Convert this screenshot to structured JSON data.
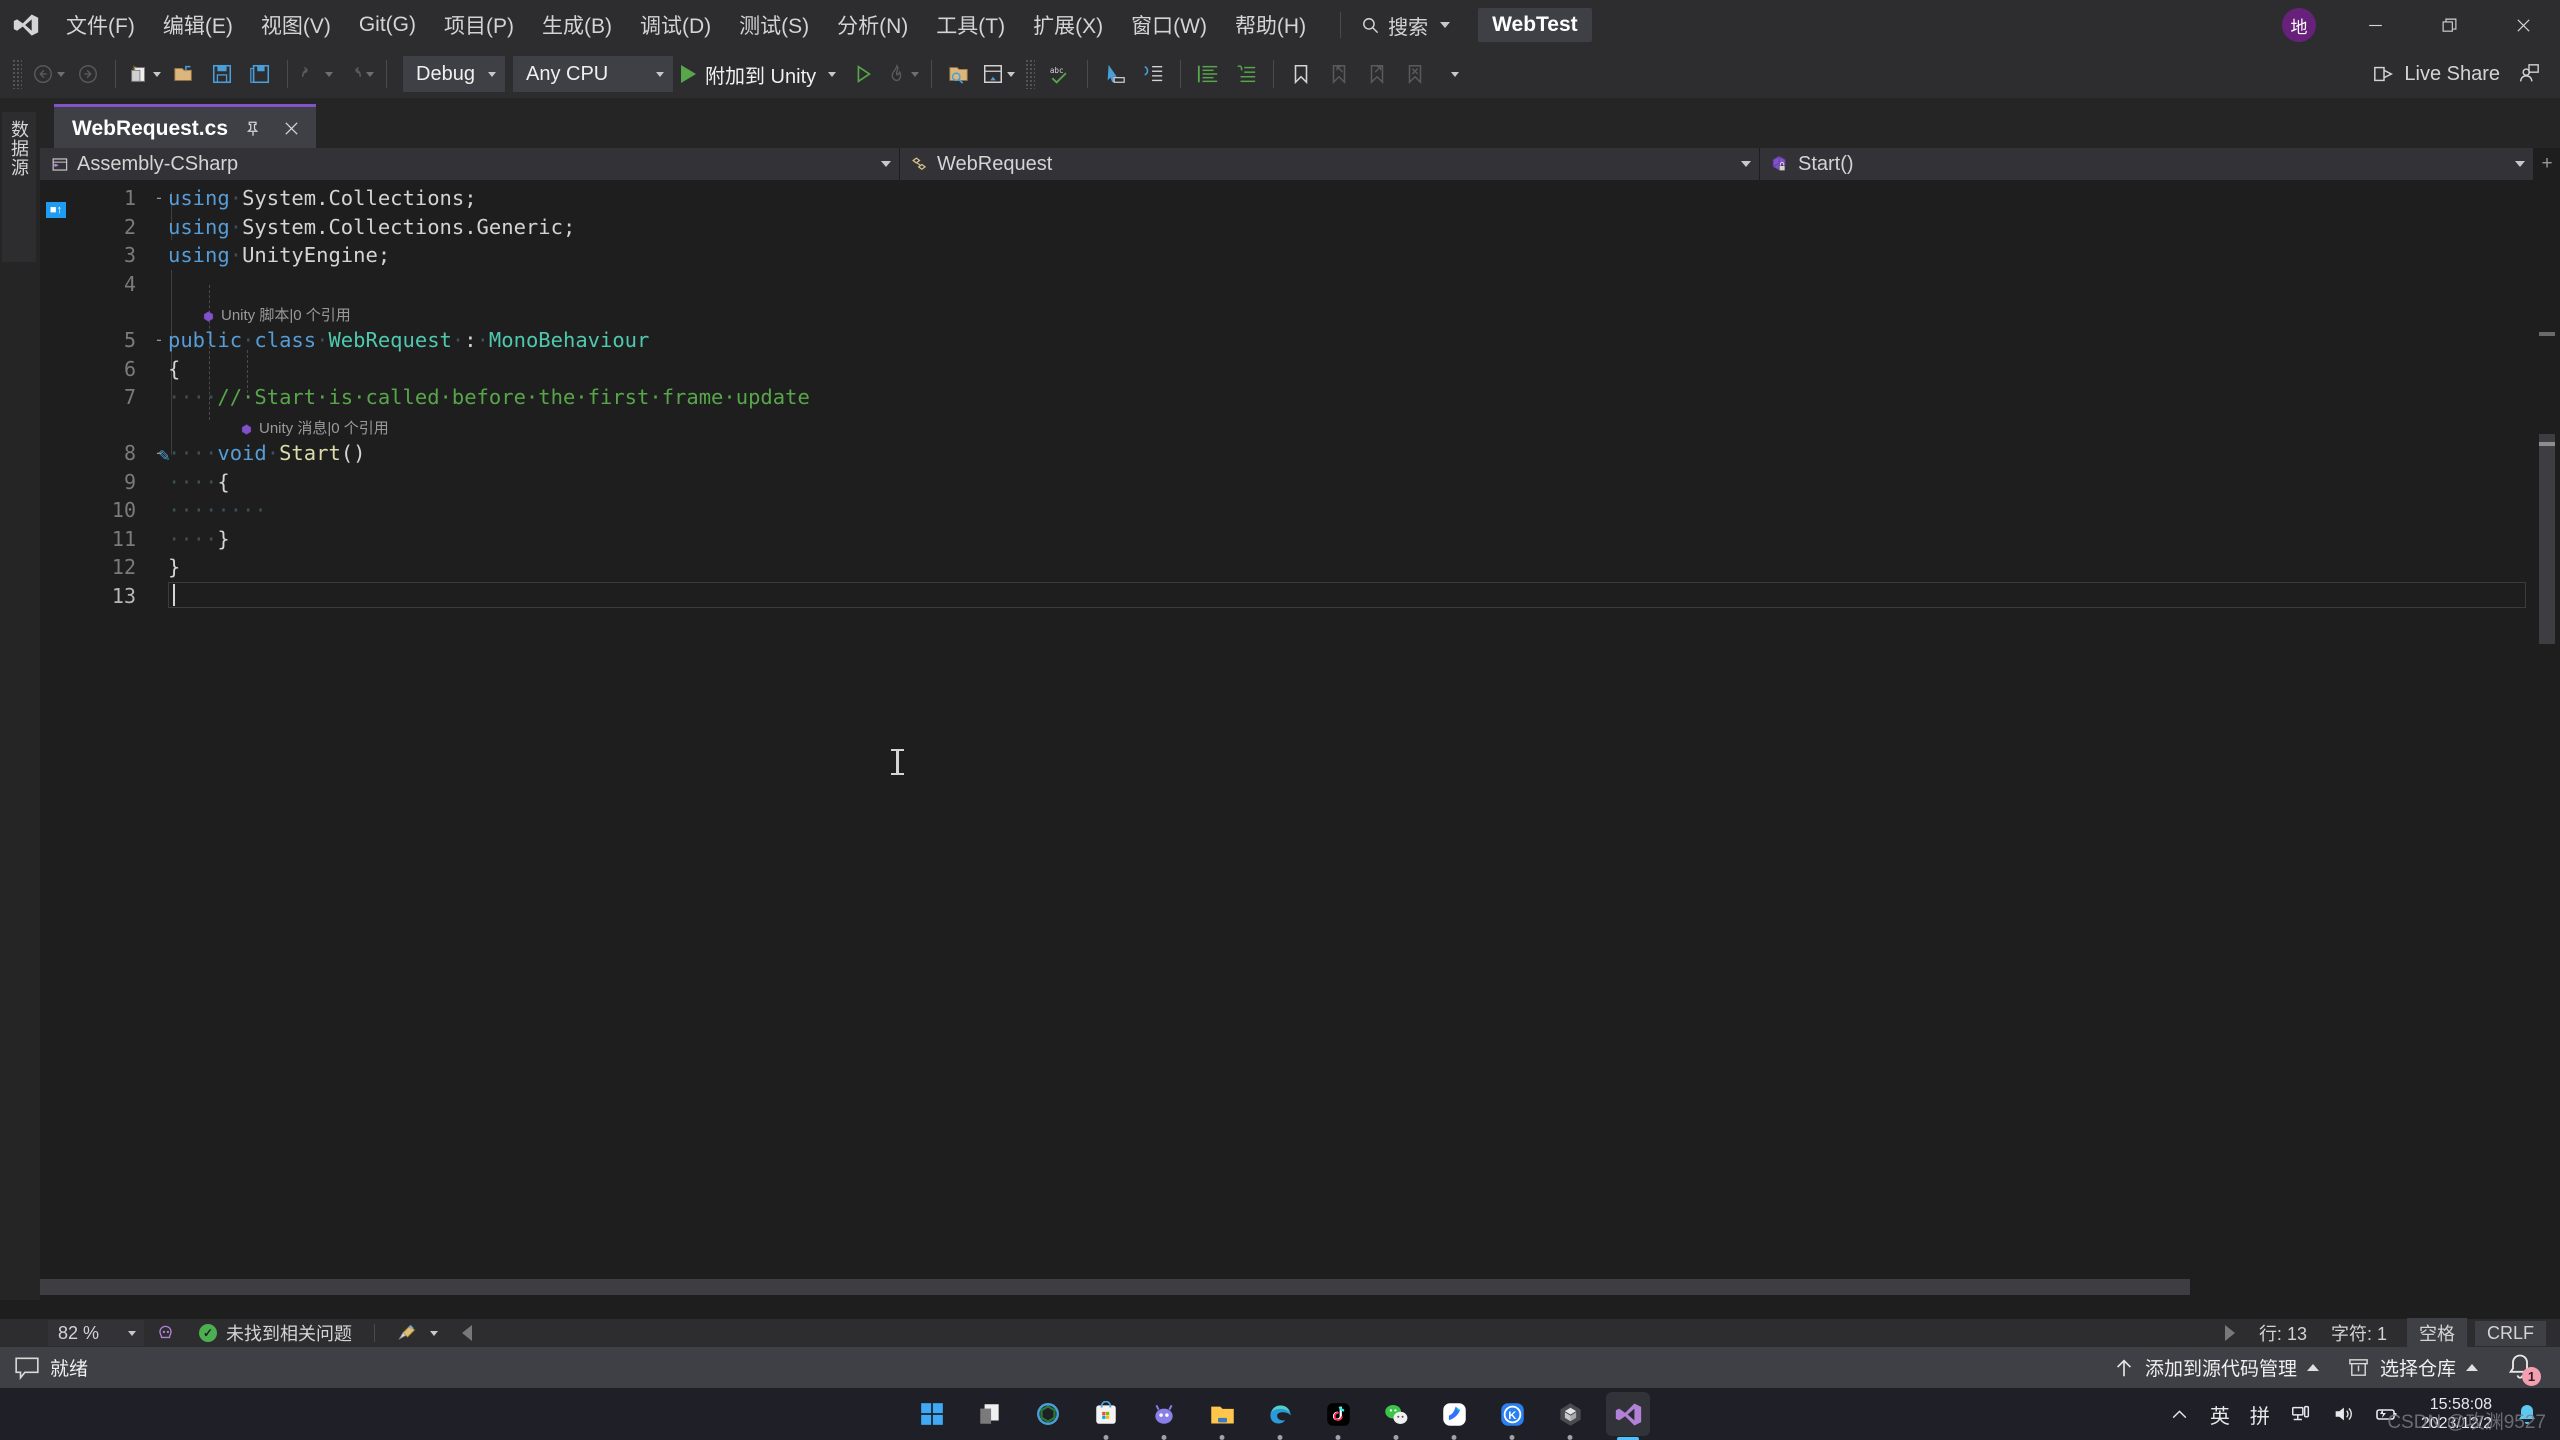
{
  "titlebar": {
    "logo_icon": "visual-studio-logo",
    "menus": [
      {
        "label": "文件(F)"
      },
      {
        "label": "编辑(E)"
      },
      {
        "label": "视图(V)"
      },
      {
        "label": "Git(G)"
      },
      {
        "label": "项目(P)"
      },
      {
        "label": "生成(B)"
      },
      {
        "label": "调试(D)"
      },
      {
        "label": "测试(S)"
      },
      {
        "label": "分析(N)"
      },
      {
        "label": "工具(T)"
      },
      {
        "label": "扩展(X)"
      },
      {
        "label": "窗口(W)"
      },
      {
        "label": "帮助(H)"
      }
    ],
    "search": {
      "label": "搜索",
      "icon": "search-icon"
    },
    "solution_name": "WebTest",
    "account_initial": "地",
    "window_controls": {
      "minimize": "minimize-icon",
      "restore": "restore-icon",
      "close": "close-icon"
    }
  },
  "toolbar": {
    "nav_back": "navigate-back",
    "nav_forward": "navigate-forward",
    "new_project": "new-project-icon",
    "open_file": "open-file-icon",
    "save": "save-icon",
    "save_all": "save-all-icon",
    "undo": "undo-icon",
    "redo": "redo-icon",
    "config": "Debug",
    "platform": "Any CPU",
    "attach_label": "附加到 Unity",
    "start_icon": "start-debug-icon",
    "start_no_debug_icon": "start-without-debugging-icon",
    "hot_reload_icon": "hot-reload-icon",
    "find_in_files_icon": "find-in-files-icon",
    "window_layout_icon": "window-layout-icon",
    "spellcheck_icon": "spellcheck-abc-icon",
    "selection_icon": "select-icon",
    "indent_icon": "indent-icon",
    "line_format_icon": "format-lines-icon",
    "wrap_icon": "wrap-lines-icon",
    "bookmark_icon": "bookmark-icon",
    "bookmark_prev_icon": "bookmark-previous-icon",
    "bookmark_next_icon": "bookmark-next-icon",
    "bookmark_clear_icon": "bookmark-clear-icon",
    "live_share": "Live Share",
    "live_share_icon": "live-share-icon",
    "live_share_person_icon": "live-share-person-icon"
  },
  "left_strip": {
    "data_sources_tab": "数据源"
  },
  "document_tab": {
    "filename": "WebRequest.cs",
    "pin_icon": "pin-icon",
    "close_icon": "close-tab-icon"
  },
  "navbar": {
    "project": "Assembly-CSharp",
    "project_icon": "project-icon",
    "type": "WebRequest",
    "type_icon": "class-icon",
    "member": "Start()",
    "member_icon": "method-private-icon"
  },
  "code": {
    "lines": [
      {
        "num": "1",
        "fold": "-",
        "text": "using System.Collections;"
      },
      {
        "num": "2",
        "fold": "",
        "text": "using System.Collections.Generic;"
      },
      {
        "num": "3",
        "fold": "",
        "text": "using UnityEngine;"
      },
      {
        "num": "4",
        "fold": "",
        "text": ""
      },
      {
        "num": "5",
        "fold": "-",
        "text": "public class WebRequest : MonoBehaviour"
      },
      {
        "num": "6",
        "fold": "",
        "text": "{"
      },
      {
        "num": "7",
        "fold": "",
        "text": "    // Start is called before the first frame update"
      },
      {
        "num": "8",
        "fold": "-",
        "text": "    void Start()"
      },
      {
        "num": "9",
        "fold": "",
        "text": "    {"
      },
      {
        "num": "10",
        "fold": "",
        "text": "        "
      },
      {
        "num": "11",
        "fold": "",
        "text": "    }"
      },
      {
        "num": "12",
        "fold": "",
        "text": "}"
      },
      {
        "num": "13",
        "fold": "",
        "text": ""
      }
    ],
    "codelens_class": "Unity 脚本|0 个引用",
    "codelens_method": "Unity 消息|0 个引用"
  },
  "statusbar": {
    "zoom": "82 %",
    "ghost_icon": "intellicode-icon",
    "issues": "未找到相关问题",
    "issues_icon": "ok-check-icon",
    "cleanup_icon": "code-cleanup-icon",
    "line": "行: 13",
    "char": "字符: 1",
    "indent": "空格",
    "eol": "CRLF"
  },
  "lowbar": {
    "ready": "就绪",
    "ready_icon": "ready-callout-icon",
    "add_source_control": "添加到源代码管理",
    "add_source_control_icon": "up-arrow-icon",
    "select_repo": "选择仓库",
    "select_repo_icon": "repository-icon",
    "notification_count": "1",
    "notification_icon": "bell-icon"
  },
  "taskbar": {
    "icons": [
      {
        "name": "start-button",
        "label": "Windows"
      },
      {
        "name": "task-view",
        "label": "任务视图"
      },
      {
        "name": "unity-hub",
        "label": "Unity Hub"
      },
      {
        "name": "microsoft-store",
        "label": "Microsoft Store"
      },
      {
        "name": "bilibili",
        "label": "哔哩哔哩"
      },
      {
        "name": "file-explorer",
        "label": "文件资源管理器"
      },
      {
        "name": "microsoft-edge",
        "label": "Microsoft Edge"
      },
      {
        "name": "tiktok-douyin",
        "label": "抖音"
      },
      {
        "name": "wechat",
        "label": "微信"
      },
      {
        "name": "feishu",
        "label": "飞书"
      },
      {
        "name": "kuaishou",
        "label": "快手"
      },
      {
        "name": "unity-editor",
        "label": "Unity"
      },
      {
        "name": "visual-studio",
        "label": "Visual Studio"
      }
    ],
    "tray": {
      "overflow_icon": "chevron-up-icon",
      "ime_lang": "英",
      "ime_mode": "拼",
      "network_icon": "network-icon",
      "volume_icon": "volume-icon",
      "battery_icon": "battery-icon",
      "time": "15:58:08",
      "date": "2023/12/2",
      "notification_icon": "notification-bell-icon"
    }
  },
  "watermark": "CSDN @攻渊9527",
  "colors": {
    "accent_purple": "#8152c9",
    "titlebar_bg": "#2d2d30",
    "editor_bg": "#1e1e1e",
    "lowbar_bg": "#3f3f46",
    "taskbar_bg": "#1f1f27",
    "keyword": "#569cd6",
    "type": "#4ec9b0",
    "comment": "#57a64a",
    "method": "#dcdcaa"
  }
}
